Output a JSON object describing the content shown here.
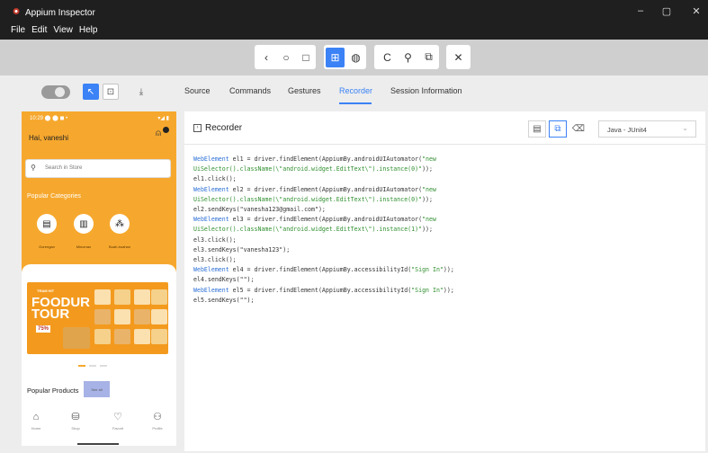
{
  "window": {
    "title": "Appium Inspector",
    "menu": [
      "File",
      "Edit",
      "View",
      "Help"
    ],
    "controls": {
      "minimize": "–",
      "maximize": "▢",
      "close": "✕"
    }
  },
  "toolbar": {
    "nav_group": [
      "‹",
      "○",
      "□"
    ],
    "mode_group": [
      "⊞",
      "◍"
    ],
    "action_group": [
      "C",
      "⚲",
      "⧉"
    ],
    "quit": "✕"
  },
  "tabs": {
    "items": [
      "Source",
      "Commands",
      "Gestures",
      "Recorder",
      "Session Information"
    ],
    "active": "Recorder"
  },
  "phone": {
    "status_left": "10:29 ⬤ ⬤ ◼ •",
    "status_right": "▾◢ ▮",
    "greeting": "Hai, vaneshi",
    "search_placeholder": "Search in Store",
    "categories_title": "Popular Categories",
    "categories": [
      "Gorengan",
      "Minuman",
      "Buah-buahan"
    ],
    "banner_small": "TRAM HIT",
    "banner_big_1": "FOODUR",
    "banner_big_2": "TOUR",
    "banner_pct": "75%",
    "popular_title": "Popular Products",
    "popular_more": "See all",
    "nav": [
      "Home",
      "Shop",
      "Favorit",
      "Profile"
    ]
  },
  "recorder": {
    "title": "Recorder",
    "language": "Java - JUnit4",
    "code": [
      [
        {
          "t": "WebElement",
          "k": "kw"
        },
        {
          "t": " el1 = driver.findElement(AppiumBy.androidUIAutomator("
        },
        {
          "t": "\"new",
          "k": "str"
        }
      ],
      [
        {
          "t": "UiSelector().className(\\\"android.widget.EditText\\\").instance(0)\"",
          "k": "str"
        },
        {
          "t": "));"
        }
      ],
      [
        {
          "t": "el1.click();"
        }
      ],
      [
        {
          "t": "WebElement",
          "k": "kw"
        },
        {
          "t": " el2 = driver.findElement(AppiumBy.androidUIAutomator("
        },
        {
          "t": "\"new",
          "k": "str"
        }
      ],
      [
        {
          "t": "UiSelector().className(\\\"android.widget.EditText\\\").instance(0)\"",
          "k": "str"
        },
        {
          "t": "));"
        }
      ],
      [
        {
          "t": "el2.sendKeys(\"vanesha123@gmail.com\");"
        }
      ],
      [
        {
          "t": "WebElement",
          "k": "kw"
        },
        {
          "t": " el3 = driver.findElement(AppiumBy.androidUIAutomator("
        },
        {
          "t": "\"new",
          "k": "str"
        }
      ],
      [
        {
          "t": "UiSelector().className(\\\"android.widget.EditText\\\").instance(1)\"",
          "k": "str"
        },
        {
          "t": "));"
        }
      ],
      [
        {
          "t": "el3.click();"
        }
      ],
      [
        {
          "t": "el3.sendKeys(\"vanesha123\");"
        }
      ],
      [
        {
          "t": "el3.click();"
        }
      ],
      [
        {
          "t": "WebElement",
          "k": "kw"
        },
        {
          "t": " el4 = driver.findElement(AppiumBy.accessibilityId("
        },
        {
          "t": "\"Sign In\"",
          "k": "str"
        },
        {
          "t": "));"
        }
      ],
      [
        {
          "t": "el4.sendKeys(\"\");"
        }
      ],
      [
        {
          "t": "WebElement",
          "k": "kw"
        },
        {
          "t": " el5 = driver.findElement(AppiumBy.accessibilityId("
        },
        {
          "t": "\"Sign In\"",
          "k": "str"
        },
        {
          "t": "));"
        }
      ],
      [
        {
          "t": "el5.sendKeys(\"\");"
        }
      ]
    ]
  }
}
